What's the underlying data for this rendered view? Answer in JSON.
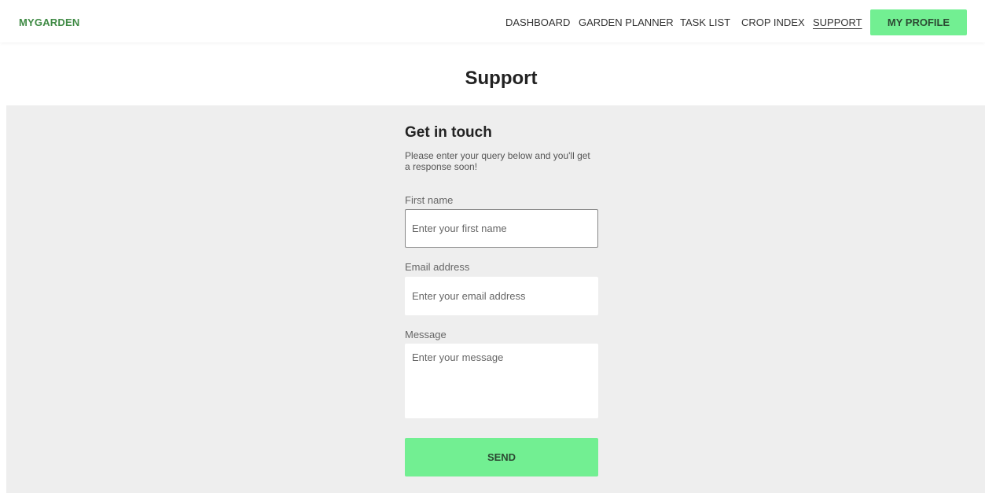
{
  "nav": {
    "brand": "MYGARDEN",
    "links": [
      {
        "label": "DASHBOARD"
      },
      {
        "label": "GARDEN PLANNER"
      },
      {
        "label": "TASK LIST"
      },
      {
        "label": "CROP INDEX"
      },
      {
        "label": "SUPPORT",
        "active": true
      }
    ],
    "profile_button": "MY PROFILE"
  },
  "page": {
    "title": "Support"
  },
  "form": {
    "heading": "Get in touch",
    "description": "Please enter your query below and you'll get a response soon!",
    "first_name": {
      "label": "First name",
      "placeholder": "Enter your first name",
      "value": ""
    },
    "email": {
      "label": "Email address",
      "placeholder": "Enter your email address",
      "value": ""
    },
    "message": {
      "label": "Message",
      "placeholder": "Enter your message",
      "value": ""
    },
    "submit_label": "SEND"
  },
  "colors": {
    "brand": "#3f8a44",
    "accent": "#72ef92",
    "panel_background": "#eeeeee"
  }
}
